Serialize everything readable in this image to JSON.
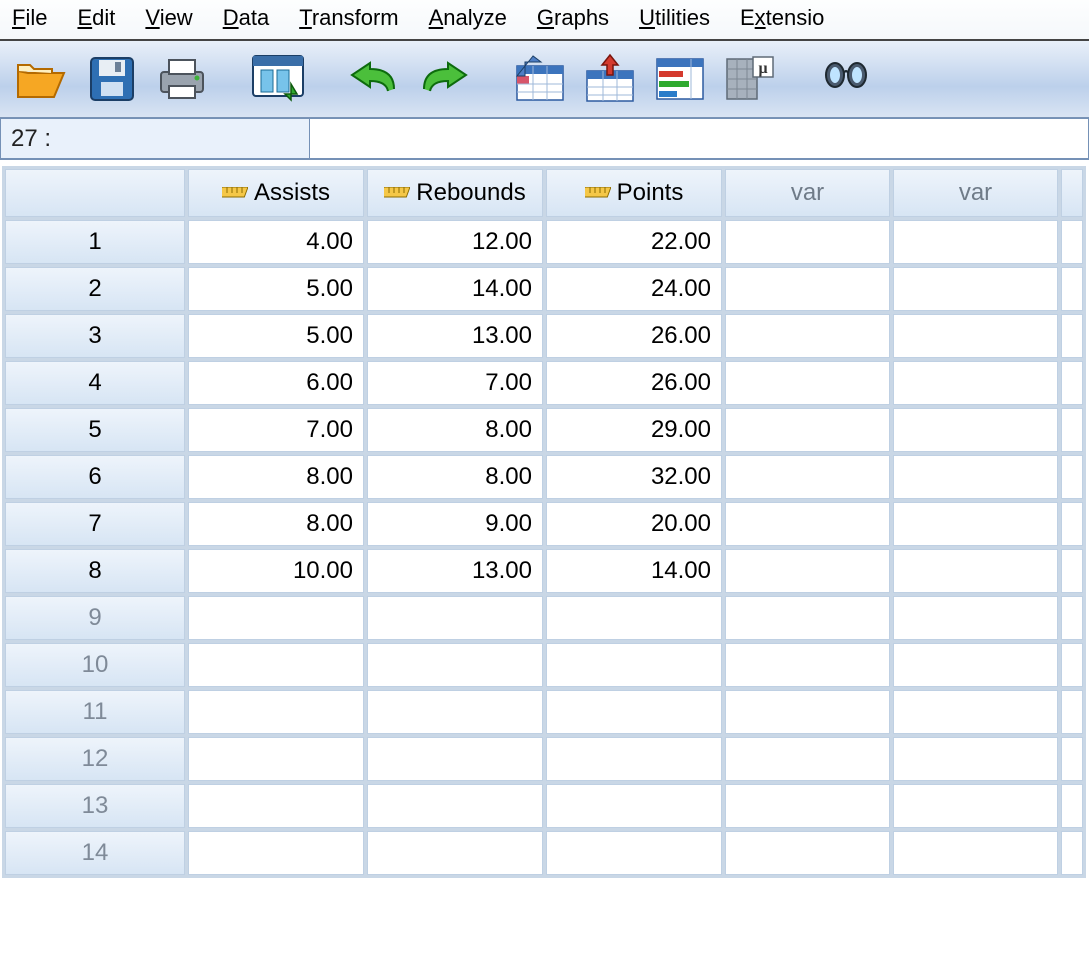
{
  "menu": {
    "file": {
      "mnemonic": "F",
      "rest": "ile"
    },
    "edit": {
      "mnemonic": "E",
      "rest": "dit"
    },
    "view": {
      "mnemonic": "V",
      "rest": "iew"
    },
    "data": {
      "mnemonic": "D",
      "rest": "ata"
    },
    "transform": {
      "mnemonic": "T",
      "rest": "ransform"
    },
    "analyze": {
      "mnemonic": "A",
      "rest": "nalyze"
    },
    "graphs": {
      "mnemonic": "G",
      "rest": "raphs"
    },
    "utilities": {
      "mnemonic": "U",
      "rest": "tilities"
    },
    "extensions": {
      "mnemonic": "x",
      "pre": "E",
      "rest": "tensio"
    }
  },
  "toolbar": {
    "open_icon": "open-file-icon",
    "save_icon": "save-icon",
    "print_icon": "print-icon",
    "recall_icon": "recall-dialog-icon",
    "undo_icon": "undo-icon",
    "redo_icon": "redo-icon",
    "goto_case_icon": "goto-case-icon",
    "insert_case_icon": "insert-cases-icon",
    "value_labels_icon": "value-labels-icon",
    "use_subset_icon": "use-variable-subsets-icon",
    "find_icon": "find-icon"
  },
  "cellbar": {
    "address": "27 :",
    "value": ""
  },
  "columns": [
    {
      "name": "Assists",
      "type": "scale"
    },
    {
      "name": "Rebounds",
      "type": "scale"
    },
    {
      "name": "Points",
      "type": "scale"
    },
    {
      "name": "var",
      "type": "empty"
    },
    {
      "name": "var",
      "type": "empty"
    }
  ],
  "rows": [
    {
      "n": "1",
      "cells": [
        "4.00",
        "12.00",
        "22.00"
      ]
    },
    {
      "n": "2",
      "cells": [
        "5.00",
        "14.00",
        "24.00"
      ]
    },
    {
      "n": "3",
      "cells": [
        "5.00",
        "13.00",
        "26.00"
      ]
    },
    {
      "n": "4",
      "cells": [
        "6.00",
        "7.00",
        "26.00"
      ]
    },
    {
      "n": "5",
      "cells": [
        "7.00",
        "8.00",
        "29.00"
      ]
    },
    {
      "n": "6",
      "cells": [
        "8.00",
        "8.00",
        "32.00"
      ]
    },
    {
      "n": "7",
      "cells": [
        "8.00",
        "9.00",
        "20.00"
      ]
    },
    {
      "n": "8",
      "cells": [
        "10.00",
        "13.00",
        "14.00"
      ]
    },
    {
      "n": "9",
      "cells": []
    },
    {
      "n": "10",
      "cells": []
    },
    {
      "n": "11",
      "cells": []
    },
    {
      "n": "12",
      "cells": []
    },
    {
      "n": "13",
      "cells": []
    },
    {
      "n": "14",
      "cells": []
    }
  ]
}
